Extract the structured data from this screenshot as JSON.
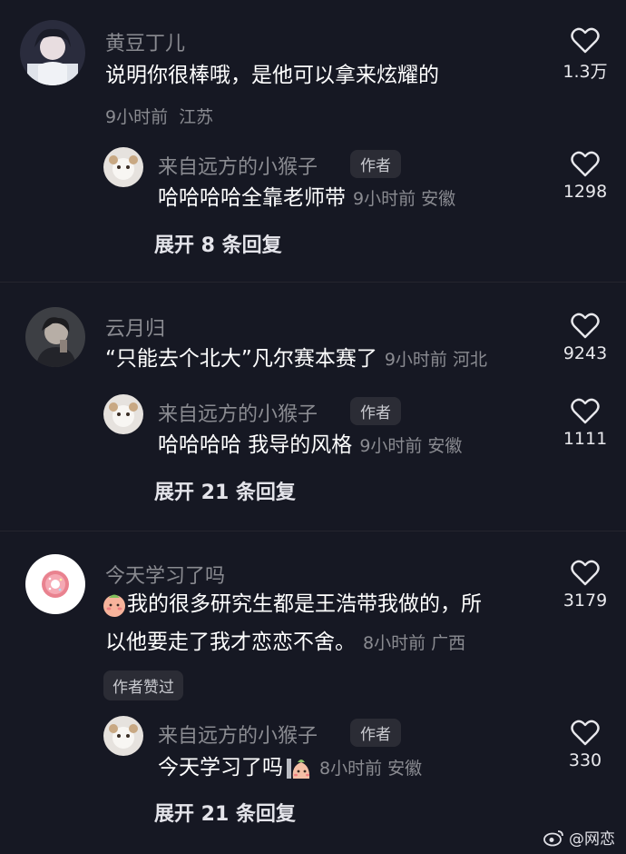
{
  "comments": [
    {
      "user": "黄豆丁儿",
      "text": "说明你很棒哦，是他可以拿来炫耀的",
      "time": "9小时前",
      "location": "江苏",
      "likes": "1.3万",
      "reply": {
        "user": "来自远方的小猴子",
        "badge": "作者",
        "text": "哈哈哈哈全靠老师带",
        "time": "9小时前",
        "location": "安徽",
        "likes": "1298"
      },
      "expand": "展开 8 条回复"
    },
    {
      "user": "云月归",
      "text": "“只能去个北大”凡尔赛本赛了",
      "time": "9小时前",
      "location": "河北",
      "likes": "9243",
      "reply": {
        "user": "来自远方的小猴子",
        "badge": "作者",
        "text": "哈哈哈哈 我导的风格",
        "time": "9小时前",
        "location": "安徽",
        "likes": "1111"
      },
      "expand": "展开 21 条回复"
    },
    {
      "user": "今天学习了吗",
      "text_line1": "我的很多研究生都是王浩带我做的，所",
      "text_line2": "以他要走了我才恋恋不舍。",
      "time": "8小时前",
      "location": "广西",
      "likes": "3179",
      "author_liked": "作者赞过",
      "reply": {
        "user": "来自远方的小猴子",
        "badge": "作者",
        "text": "今天学习了吗",
        "time": "8小时前",
        "location": "安徽",
        "likes": "330"
      },
      "expand": "展开 21 条回复"
    }
  ],
  "watermark": "@网恋",
  "colors": {
    "background": "#161823",
    "secondary_text": "#8a8b91",
    "primary_text": "#ffffff"
  },
  "icons": [
    "heart-outline-icon",
    "weibo-icon",
    "blush-face-emoji",
    "peach-face-emoji"
  ]
}
